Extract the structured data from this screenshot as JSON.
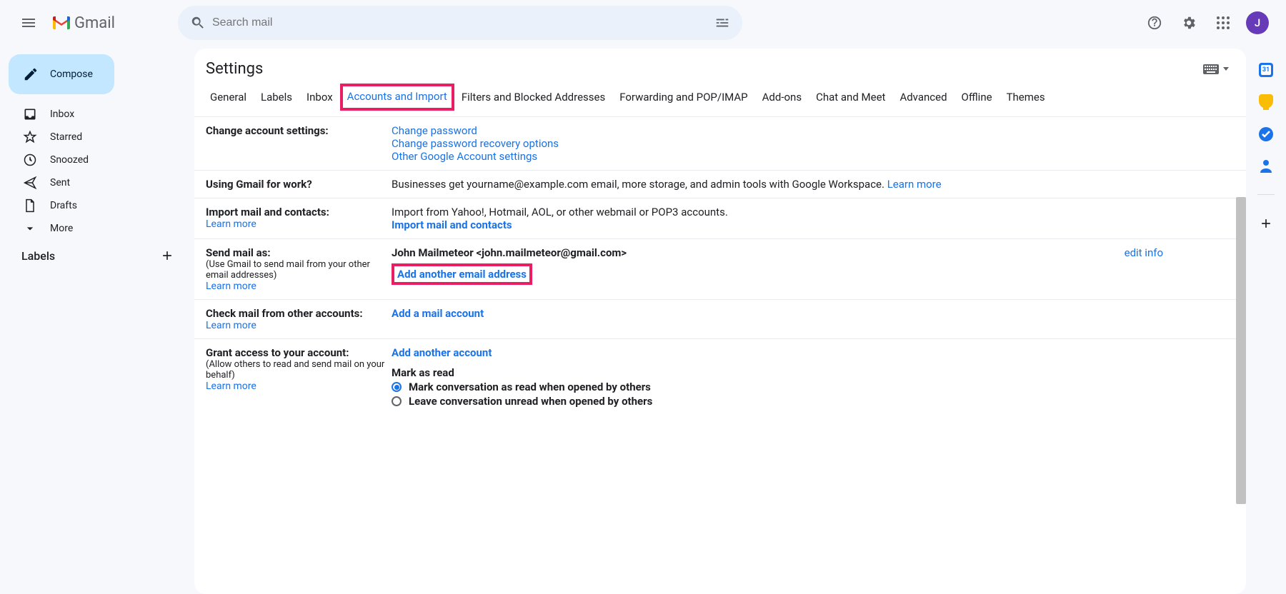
{
  "header": {
    "app_name": "Gmail",
    "search_placeholder": "Search mail",
    "avatar_initial": "J"
  },
  "sidebar": {
    "compose": "Compose",
    "items": [
      {
        "label": "Inbox",
        "icon": "inbox"
      },
      {
        "label": "Starred",
        "icon": "star"
      },
      {
        "label": "Snoozed",
        "icon": "clock"
      },
      {
        "label": "Sent",
        "icon": "send"
      },
      {
        "label": "Drafts",
        "icon": "file"
      },
      {
        "label": "More",
        "icon": "chevron-down"
      }
    ],
    "labels_header": "Labels"
  },
  "settings": {
    "title": "Settings",
    "tabs": [
      "General",
      "Labels",
      "Inbox",
      "Accounts and Import",
      "Filters and Blocked Addresses",
      "Forwarding and POP/IMAP",
      "Add-ons",
      "Chat and Meet",
      "Advanced",
      "Offline",
      "Themes"
    ],
    "active_tab": "Accounts and Import"
  },
  "sections": {
    "change_account": {
      "label": "Change account settings:",
      "links": [
        "Change password",
        "Change password recovery options",
        "Other Google Account settings"
      ]
    },
    "work": {
      "label": "Using Gmail for work?",
      "text": "Businesses get yourname@example.com email, more storage, and admin tools with Google Workspace. ",
      "learn": "Learn more"
    },
    "import": {
      "label": "Import mail and contacts:",
      "learn": "Learn more",
      "desc": "Import from Yahoo!, Hotmail, AOL, or other webmail or POP3 accounts.",
      "action": "Import mail and contacts"
    },
    "send_as": {
      "label": "Send mail as:",
      "desc": "(Use Gmail to send mail from your other email addresses)",
      "learn": "Learn more",
      "identity": "John Mailmeteor <john.mailmeteor@gmail.com>",
      "edit": "edit info",
      "add": "Add another email address"
    },
    "check_mail": {
      "label": "Check mail from other accounts:",
      "learn": "Learn more",
      "action": "Add a mail account"
    },
    "grant": {
      "label": "Grant access to your account:",
      "desc": "(Allow others to read and send mail on your behalf)",
      "learn": "Learn more",
      "action": "Add another account",
      "mark_label": "Mark as read",
      "opt1": "Mark conversation as read when opened by others",
      "opt2": "Leave conversation unread when opened by others"
    }
  }
}
